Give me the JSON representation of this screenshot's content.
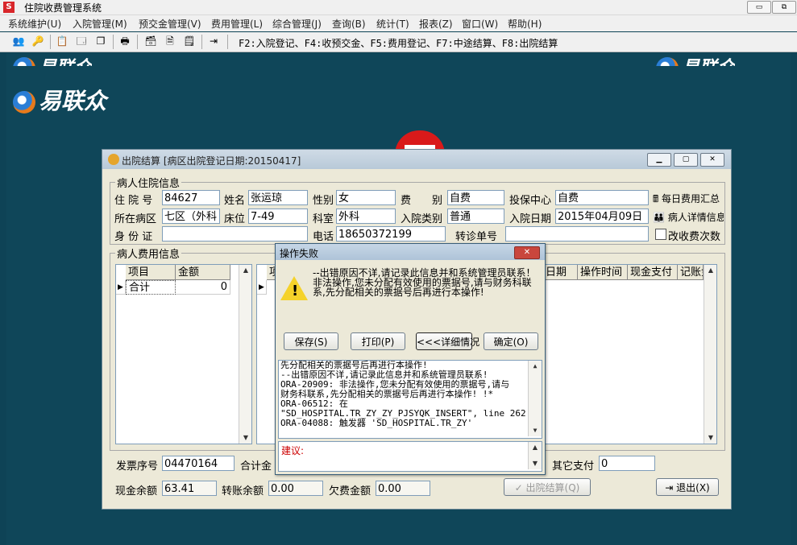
{
  "app": {
    "title": "住院收费管理系统"
  },
  "menu": [
    "系统维护(U)",
    "入院管理(M)",
    "预交金管理(V)",
    "费用管理(L)",
    "综合管理(J)",
    "查询(B)",
    "统计(T)",
    "报表(Z)",
    "窗口(W)",
    "帮助(H)"
  ],
  "toolbar_hint": "F2:入院登记、F4:收预交金、F5:费用登记、F7:中途结算、F8:出院结算",
  "brand": "易联众",
  "settle_window": {
    "title": "出院结算 [病区出院登记日期:20150417]",
    "patient_group": "病人住院信息",
    "labels": {
      "inpatient_no": "住 院 号",
      "name": "姓名",
      "gender": "性别",
      "fee_type": "费　　别",
      "insurance_center": "投保中心",
      "ward": "所在病区",
      "bed": "床位",
      "dept": "科室",
      "admit_type": "入院类别",
      "admit_date": "入院日期",
      "id_card": "身 份 证",
      "phone": "电话",
      "referral_no": "转诊单号"
    },
    "values": {
      "inpatient_no": "84627",
      "name": "张运琼",
      "gender": "女",
      "fee_type": "自费",
      "insurance_center": "自费",
      "ward": "七区（外科",
      "bed": "7-49",
      "dept": "外科",
      "admit_type": "普通",
      "admit_date": "2015年04月09日",
      "id_card": "",
      "phone": "18650372199",
      "referral_no": ""
    },
    "side_buttons": {
      "daily_summary": "每日费用汇总",
      "patient_detail": "病人详情信息",
      "change_count": "改收费次数"
    },
    "fee_group": "病人费用信息",
    "fee_grid": {
      "headers": [
        "项目",
        "金额"
      ],
      "rows": [
        [
          "合计",
          "0"
        ]
      ]
    },
    "detail_grid": {
      "headers": [
        "项",
        "",
        "非日期",
        "操作时间",
        "现金支付",
        "记账金"
      ]
    },
    "bottom": {
      "invoice_label": "发票序号",
      "invoice_value": "04470164",
      "total_label": "合计金",
      "other_pay_label": "其它支付",
      "other_pay_value": "0",
      "cash_balance_label": "现金余额",
      "cash_balance_value": "63.41",
      "transfer_balance_label": "转账余额",
      "transfer_balance_value": "0.00",
      "owed_label": "欠费金额",
      "owed_value": "0.00",
      "settle_button": "出院结算(Q)",
      "exit_button": "退出(X)"
    }
  },
  "error_dialog": {
    "title": "操作失败",
    "message": "--出错原因不详,请记录此信息并和系统管理员联系！ 非法操作,您未分配有效使用的票据号,请与财务科联系,先分配相关的票据号后再进行本操作!",
    "buttons": {
      "save": "保存(S)",
      "print": "打印(P)",
      "details": "<<<详细情况",
      "ok": "确定(O)"
    },
    "detail_lines": [
      "先分配相关的票据号后再进行本操作!",
      "--出错原因不详,请记录此信息并和系统管理员联系!",
      "ORA-20909: 非法操作,您未分配有效使用的票据号,请与",
      "财务科联系,先分配相关的票据号后再进行本操作! !*",
      "ORA-06512: 在",
      "\"SD_HOSPITAL.TR_ZY_ZY_PJSYQK_INSERT\", line 262",
      "ORA-04088: 触发器 'SD_HOSPITAL.TR_ZY'"
    ],
    "suggestion_label": "建议:"
  },
  "colors": {
    "desktop": "#0f4659",
    "dialog_title": "#aec3d8",
    "close_red": "#c9463d",
    "warning_yellow": "#f5d22a"
  }
}
